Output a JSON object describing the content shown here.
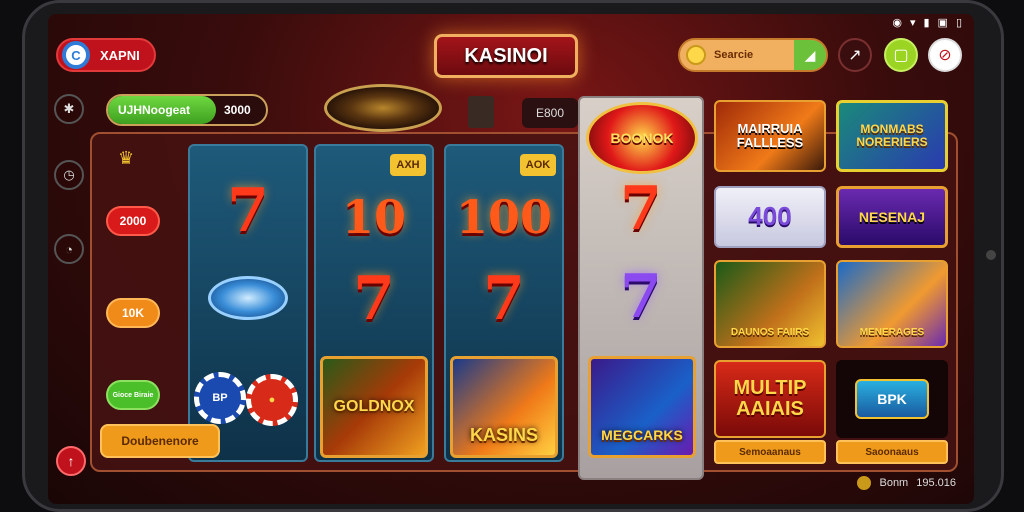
{
  "status_bar": {
    "icons": [
      "wifi-icon",
      "signal-icon",
      "signal-bars-icon",
      "sim-icon",
      "battery-icon"
    ]
  },
  "header": {
    "brand_label": "XAPNI",
    "title": "KASINOI",
    "search_label": "Searcie"
  },
  "balance": {
    "name": "UJHNoogeat",
    "value": "3000"
  },
  "info_pill": "E800",
  "side_chips": [
    "2000",
    "10K",
    "Gioce Biraie"
  ],
  "bottom_button": "Doubenenore",
  "reels": [
    {
      "badge": "",
      "symbols": [
        "7",
        "",
        ""
      ]
    },
    {
      "badge": "AXH",
      "symbols": [
        "10",
        "7",
        ""
      ],
      "tile": "GOLDNOX"
    },
    {
      "badge": "AOK",
      "symbols": [
        "100",
        "7",
        ""
      ],
      "tile": "KASINS"
    }
  ],
  "bonus": {
    "wheel_label": "BOONOK",
    "symbol": "7",
    "tile": "MEGCARKS"
  },
  "game_cards": [
    {
      "label": "MAIRRUIA FALLLESS"
    },
    {
      "label": "MONMABS NORERIERS"
    },
    {
      "label": "400"
    },
    {
      "label": "NESENAJ"
    },
    {
      "label": "DAUNOS FAIIRS"
    },
    {
      "label": "MENERAGES"
    },
    {
      "label": "MULTIP AAIAIS",
      "footer": "Semoaanaus"
    },
    {
      "label": "BPK",
      "footer": "Saoonaaus"
    }
  ],
  "footer": {
    "label": "Bonm",
    "value": "195.016"
  },
  "colors": {
    "accent_red": "#c0121c",
    "accent_gold": "#f09a1c",
    "accent_green": "#4bbf2a"
  }
}
